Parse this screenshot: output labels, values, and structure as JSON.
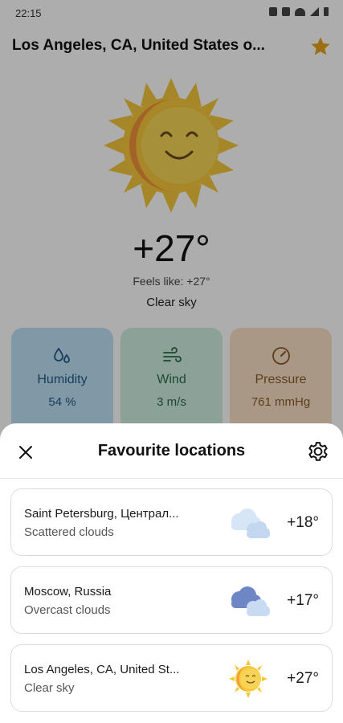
{
  "status": {
    "time": "22:15"
  },
  "location": {
    "title": "Los Angeles, CA, United States o..."
  },
  "current": {
    "temp": "+27°",
    "feels_like": "Feels like: +27°",
    "condition": "Clear sky",
    "icon": "sun-icon"
  },
  "cards": [
    {
      "label": "Humidity",
      "value": "54 %",
      "icon": "droplets-icon",
      "color": "#bfe0f6"
    },
    {
      "label": "Wind",
      "value": "3 m/s",
      "icon": "wind-icon",
      "color": "#cfeedf"
    },
    {
      "label": "Pressure",
      "value": "761 mmHg",
      "icon": "gauge-icon",
      "color": "#fbe1c8"
    }
  ],
  "sheet": {
    "title": "Favourite locations",
    "close_icon": "close-icon",
    "settings_icon": "gear-icon",
    "items": [
      {
        "name": "Saint Petersburg, Централ...",
        "description": "Scattered clouds",
        "temp": "+18°",
        "icon": "scattered-clouds-icon"
      },
      {
        "name": "Moscow, Russia",
        "description": "Overcast clouds",
        "temp": "+17°",
        "icon": "overcast-clouds-icon"
      },
      {
        "name": "Los Angeles, CA, United St...",
        "description": "Clear sky",
        "temp": "+27°",
        "icon": "sun-icon"
      }
    ]
  },
  "colors": {
    "star": "#e8a317",
    "sun": "#f6c83b",
    "accent_dim": "rgba(0,0,0,0.32)"
  }
}
